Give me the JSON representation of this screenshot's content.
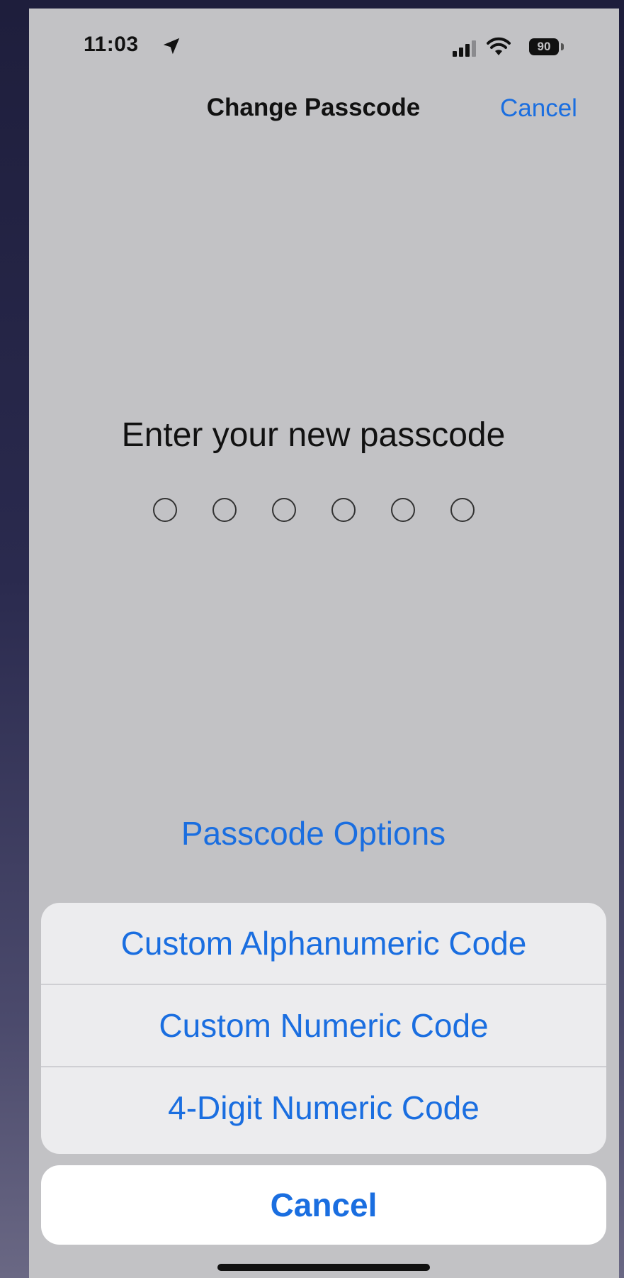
{
  "status_bar": {
    "time": "11:03",
    "battery_level": "90",
    "icons": [
      "location-arrow-icon",
      "cellular-signal-icon",
      "wifi-icon",
      "battery-icon"
    ]
  },
  "nav": {
    "title": "Change Passcode",
    "cancel_label": "Cancel"
  },
  "passcode": {
    "prompt": "Enter your new passcode",
    "digit_count": 6
  },
  "options_link": "Passcode Options",
  "action_sheet": {
    "items": [
      {
        "label": "Custom Alphanumeric Code"
      },
      {
        "label": "Custom Numeric Code"
      },
      {
        "label": "4-Digit Numeric Code"
      }
    ],
    "cancel_label": "Cancel"
  },
  "colors": {
    "accent": "#1a6ee0",
    "screen_bg": "#c2c2c5",
    "sheet_bg": "#ececee"
  }
}
